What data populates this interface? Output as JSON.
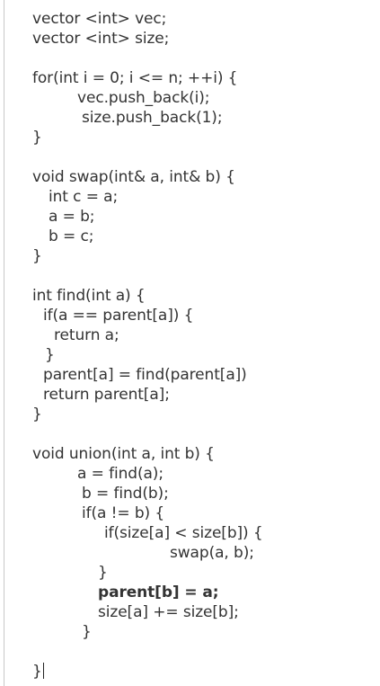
{
  "editor": {
    "lines": [
      {
        "text": "vector <int> vec;",
        "indent": 0,
        "bold": false
      },
      {
        "text": "vector <int> size;",
        "indent": 0,
        "bold": false
      },
      {
        "text": "",
        "indent": 0,
        "bold": false
      },
      {
        "text": "for(int i = 0; i <= n; ++i) {",
        "indent": 0,
        "bold": false
      },
      {
        "text": "vec.push_back(i);",
        "indent": 50,
        "bold": false
      },
      {
        "text": "size.push_back(1);",
        "indent": 55,
        "bold": false
      },
      {
        "text": "}",
        "indent": 0,
        "bold": false
      },
      {
        "text": "",
        "indent": 0,
        "bold": false
      },
      {
        "text": "void swap(int& a, int& b) {",
        "indent": 0,
        "bold": false
      },
      {
        "text": "int c = a;",
        "indent": 18,
        "bold": false
      },
      {
        "text": "a = b;",
        "indent": 18,
        "bold": false
      },
      {
        "text": "b = c;",
        "indent": 18,
        "bold": false
      },
      {
        "text": "}",
        "indent": 0,
        "bold": false
      },
      {
        "text": "",
        "indent": 0,
        "bold": false
      },
      {
        "text": "int find(int a) {",
        "indent": 0,
        "bold": false
      },
      {
        "text": "if(a == parent[a]) {",
        "indent": 12,
        "bold": false
      },
      {
        "text": "return a;",
        "indent": 24,
        "bold": false
      },
      {
        "text": "}",
        "indent": 14,
        "bold": false
      },
      {
        "text": "parent[a] = find(parent[a])",
        "indent": 12,
        "bold": false
      },
      {
        "text": "return parent[a];",
        "indent": 12,
        "bold": false
      },
      {
        "text": "}",
        "indent": 0,
        "bold": false
      },
      {
        "text": "",
        "indent": 0,
        "bold": false
      },
      {
        "text": "void union(int a, int b) {",
        "indent": 0,
        "bold": false
      },
      {
        "text": "a = find(a);",
        "indent": 50,
        "bold": false
      },
      {
        "text": "b = find(b);",
        "indent": 55,
        "bold": false
      },
      {
        "text": "if(a != b) {",
        "indent": 55,
        "bold": false
      },
      {
        "text": "if(size[a] < size[b]) {",
        "indent": 80,
        "bold": false
      },
      {
        "text": "swap(a, b);",
        "indent": 153,
        "bold": false
      },
      {
        "text": "}",
        "indent": 73,
        "bold": false
      },
      {
        "text": "parent[b] = a;",
        "indent": 73,
        "bold": true
      },
      {
        "text": "size[a] += size[b];",
        "indent": 73,
        "bold": false
      },
      {
        "text": "}",
        "indent": 55,
        "bold": false
      },
      {
        "text": "",
        "indent": 0,
        "bold": false
      },
      {
        "text": "}",
        "indent": 0,
        "bold": false,
        "caret": true
      }
    ]
  }
}
